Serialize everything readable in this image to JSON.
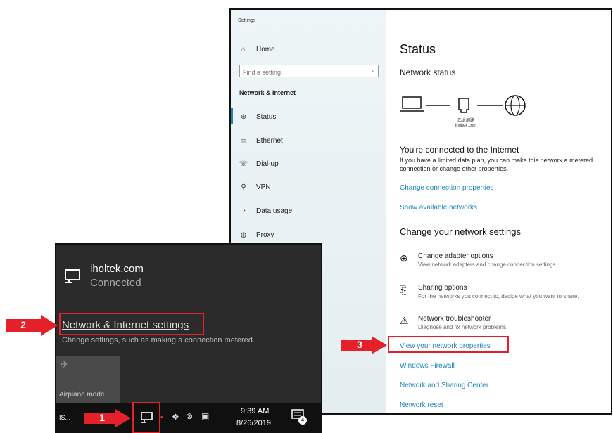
{
  "settings": {
    "window_title": "Settings",
    "sidebar": {
      "home": "Home",
      "search_placeholder": "Find a setting",
      "section_title": "Network & Internet",
      "items": [
        {
          "label": "Status",
          "icon": "status-icon"
        },
        {
          "label": "Ethernet",
          "icon": "ethernet-icon"
        },
        {
          "label": "Dial-up",
          "icon": "dialup-icon"
        },
        {
          "label": "VPN",
          "icon": "vpn-icon"
        },
        {
          "label": "Data usage",
          "icon": "data-usage-icon"
        },
        {
          "label": "Proxy",
          "icon": "proxy-icon"
        }
      ]
    },
    "main": {
      "title": "Status",
      "network_status": "Network status",
      "diagram_label_1": "乙太網路",
      "diagram_label_2": "iholtek.com",
      "connected_heading": "You're connected to the Internet",
      "connected_desc": "If you have a limited data plan, you can make this network a metered connection or change other properties.",
      "link_change_props": "Change connection properties",
      "link_show_networks": "Show available networks",
      "change_heading": "Change your network settings",
      "options": [
        {
          "title": "Change adapter options",
          "desc": "View network adapters and change connection settings.",
          "icon": "adapter-icon"
        },
        {
          "title": "Sharing options",
          "desc": "For the networks you connect to, decide what you want to share.",
          "icon": "sharing-icon"
        },
        {
          "title": "Network troubleshooter",
          "desc": "Diagnose and fix network problems.",
          "icon": "warning-icon"
        }
      ],
      "links": [
        "View your network properties",
        "Windows Firewall",
        "Network and Sharing Center",
        "Network reset"
      ]
    }
  },
  "flyout": {
    "network_name": "iholtek.com",
    "network_status": "Connected",
    "settings_link": "Network & Internet settings",
    "settings_desc": "Change settings, such as making a connection metered.",
    "airplane_label": "Airplane mode"
  },
  "taskbar": {
    "app_stub": "IS...",
    "time": "9:39 AM",
    "date": "8/26/2019",
    "notification_count": "4"
  },
  "callouts": {
    "one": "1",
    "two": "2",
    "three": "3"
  },
  "colors": {
    "accent_link": "#1a86b8",
    "callout_red": "#e4202a",
    "flyout_bg": "#2b2b2b"
  }
}
